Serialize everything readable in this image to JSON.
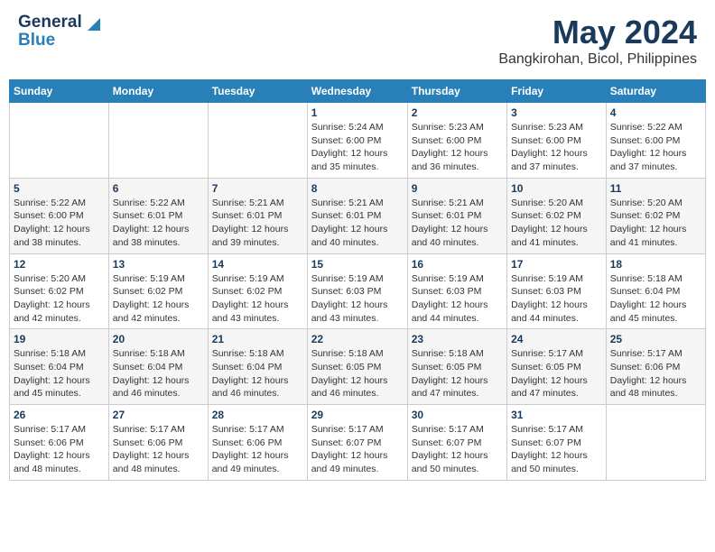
{
  "logo": {
    "line1": "General",
    "line2": "Blue"
  },
  "title": "May 2024",
  "subtitle": "Bangkirohan, Bicol, Philippines",
  "days_header": [
    "Sunday",
    "Monday",
    "Tuesday",
    "Wednesday",
    "Thursday",
    "Friday",
    "Saturday"
  ],
  "weeks": [
    [
      {
        "day": "",
        "info": ""
      },
      {
        "day": "",
        "info": ""
      },
      {
        "day": "",
        "info": ""
      },
      {
        "day": "1",
        "info": "Sunrise: 5:24 AM\nSunset: 6:00 PM\nDaylight: 12 hours\nand 35 minutes."
      },
      {
        "day": "2",
        "info": "Sunrise: 5:23 AM\nSunset: 6:00 PM\nDaylight: 12 hours\nand 36 minutes."
      },
      {
        "day": "3",
        "info": "Sunrise: 5:23 AM\nSunset: 6:00 PM\nDaylight: 12 hours\nand 37 minutes."
      },
      {
        "day": "4",
        "info": "Sunrise: 5:22 AM\nSunset: 6:00 PM\nDaylight: 12 hours\nand 37 minutes."
      }
    ],
    [
      {
        "day": "5",
        "info": "Sunrise: 5:22 AM\nSunset: 6:00 PM\nDaylight: 12 hours\nand 38 minutes."
      },
      {
        "day": "6",
        "info": "Sunrise: 5:22 AM\nSunset: 6:01 PM\nDaylight: 12 hours\nand 38 minutes."
      },
      {
        "day": "7",
        "info": "Sunrise: 5:21 AM\nSunset: 6:01 PM\nDaylight: 12 hours\nand 39 minutes."
      },
      {
        "day": "8",
        "info": "Sunrise: 5:21 AM\nSunset: 6:01 PM\nDaylight: 12 hours\nand 40 minutes."
      },
      {
        "day": "9",
        "info": "Sunrise: 5:21 AM\nSunset: 6:01 PM\nDaylight: 12 hours\nand 40 minutes."
      },
      {
        "day": "10",
        "info": "Sunrise: 5:20 AM\nSunset: 6:02 PM\nDaylight: 12 hours\nand 41 minutes."
      },
      {
        "day": "11",
        "info": "Sunrise: 5:20 AM\nSunset: 6:02 PM\nDaylight: 12 hours\nand 41 minutes."
      }
    ],
    [
      {
        "day": "12",
        "info": "Sunrise: 5:20 AM\nSunset: 6:02 PM\nDaylight: 12 hours\nand 42 minutes."
      },
      {
        "day": "13",
        "info": "Sunrise: 5:19 AM\nSunset: 6:02 PM\nDaylight: 12 hours\nand 42 minutes."
      },
      {
        "day": "14",
        "info": "Sunrise: 5:19 AM\nSunset: 6:02 PM\nDaylight: 12 hours\nand 43 minutes."
      },
      {
        "day": "15",
        "info": "Sunrise: 5:19 AM\nSunset: 6:03 PM\nDaylight: 12 hours\nand 43 minutes."
      },
      {
        "day": "16",
        "info": "Sunrise: 5:19 AM\nSunset: 6:03 PM\nDaylight: 12 hours\nand 44 minutes."
      },
      {
        "day": "17",
        "info": "Sunrise: 5:19 AM\nSunset: 6:03 PM\nDaylight: 12 hours\nand 44 minutes."
      },
      {
        "day": "18",
        "info": "Sunrise: 5:18 AM\nSunset: 6:04 PM\nDaylight: 12 hours\nand 45 minutes."
      }
    ],
    [
      {
        "day": "19",
        "info": "Sunrise: 5:18 AM\nSunset: 6:04 PM\nDaylight: 12 hours\nand 45 minutes."
      },
      {
        "day": "20",
        "info": "Sunrise: 5:18 AM\nSunset: 6:04 PM\nDaylight: 12 hours\nand 46 minutes."
      },
      {
        "day": "21",
        "info": "Sunrise: 5:18 AM\nSunset: 6:04 PM\nDaylight: 12 hours\nand 46 minutes."
      },
      {
        "day": "22",
        "info": "Sunrise: 5:18 AM\nSunset: 6:05 PM\nDaylight: 12 hours\nand 46 minutes."
      },
      {
        "day": "23",
        "info": "Sunrise: 5:18 AM\nSunset: 6:05 PM\nDaylight: 12 hours\nand 47 minutes."
      },
      {
        "day": "24",
        "info": "Sunrise: 5:17 AM\nSunset: 6:05 PM\nDaylight: 12 hours\nand 47 minutes."
      },
      {
        "day": "25",
        "info": "Sunrise: 5:17 AM\nSunset: 6:06 PM\nDaylight: 12 hours\nand 48 minutes."
      }
    ],
    [
      {
        "day": "26",
        "info": "Sunrise: 5:17 AM\nSunset: 6:06 PM\nDaylight: 12 hours\nand 48 minutes."
      },
      {
        "day": "27",
        "info": "Sunrise: 5:17 AM\nSunset: 6:06 PM\nDaylight: 12 hours\nand 48 minutes."
      },
      {
        "day": "28",
        "info": "Sunrise: 5:17 AM\nSunset: 6:06 PM\nDaylight: 12 hours\nand 49 minutes."
      },
      {
        "day": "29",
        "info": "Sunrise: 5:17 AM\nSunset: 6:07 PM\nDaylight: 12 hours\nand 49 minutes."
      },
      {
        "day": "30",
        "info": "Sunrise: 5:17 AM\nSunset: 6:07 PM\nDaylight: 12 hours\nand 50 minutes."
      },
      {
        "day": "31",
        "info": "Sunrise: 5:17 AM\nSunset: 6:07 PM\nDaylight: 12 hours\nand 50 minutes."
      },
      {
        "day": "",
        "info": ""
      }
    ]
  ]
}
